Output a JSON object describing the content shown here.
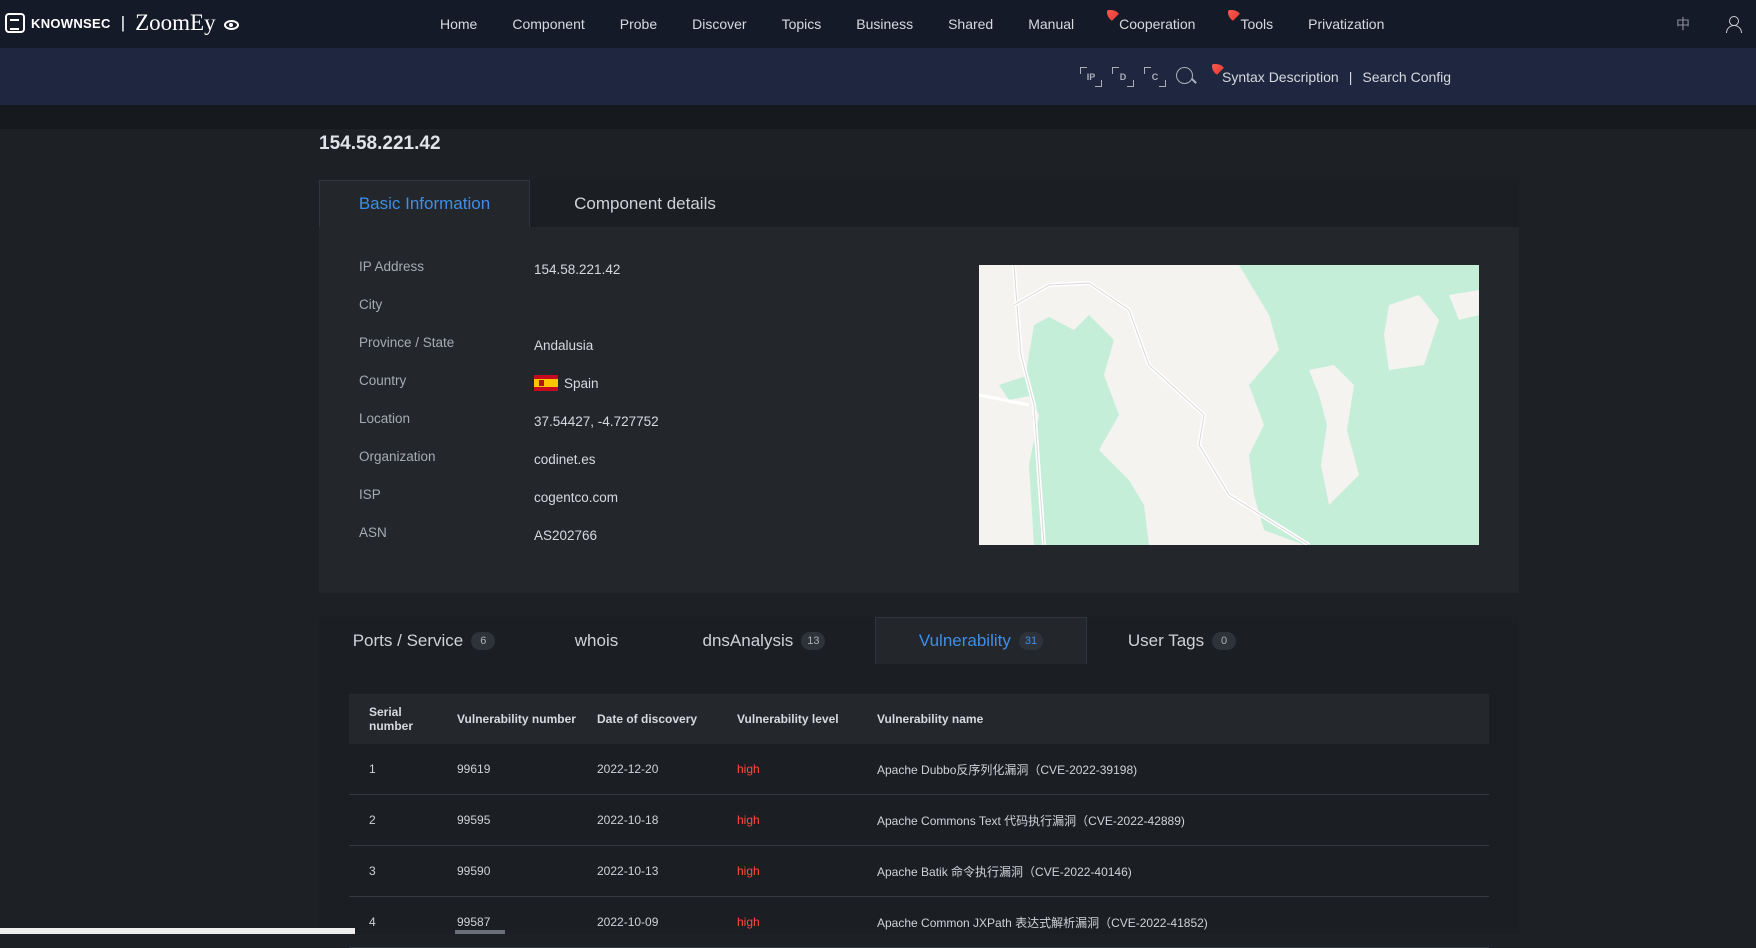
{
  "brand": {
    "company": "KNOWNSEC",
    "separator": "|",
    "product": "ZoomEy"
  },
  "nav": {
    "items": [
      {
        "label": "Home"
      },
      {
        "label": "Component"
      },
      {
        "label": "Probe"
      },
      {
        "label": "Discover"
      },
      {
        "label": "Topics"
      },
      {
        "label": "Business"
      },
      {
        "label": "Shared"
      },
      {
        "label": "Manual"
      },
      {
        "label": "Cooperation",
        "flag": true
      },
      {
        "label": "Tools",
        "flag": true
      },
      {
        "label": "Privatization"
      }
    ],
    "language": "中"
  },
  "search": {
    "tool_icons": [
      "IP",
      "D",
      "C"
    ],
    "syntax_label": "Syntax Description",
    "separator": "|",
    "config_label": "Search Config"
  },
  "host": {
    "ip_title": "154.58.221.42"
  },
  "tabs_top": {
    "basic": "Basic Information",
    "component": "Component details"
  },
  "basic_info": {
    "ip_label": "IP Address",
    "ip_value": "154.58.221.42",
    "city_label": "City",
    "city_value": "",
    "province_label": "Province / State",
    "province_value": "Andalusia",
    "country_label": "Country",
    "country_value": "Spain",
    "location_label": "Location",
    "location_value": "37.54427, -4.727752",
    "org_label": "Organization",
    "org_value": "codinet.es",
    "isp_label": "ISP",
    "isp_value": "cogentco.com",
    "asn_label": "ASN",
    "asn_value": "AS202766"
  },
  "tabs_bottom": {
    "ports": {
      "label": "Ports / Service",
      "count": "6"
    },
    "whois": {
      "label": "whois"
    },
    "dns": {
      "label": "dnsAnalysis",
      "count": "13"
    },
    "vuln": {
      "label": "Vulnerability",
      "count": "31"
    },
    "tags": {
      "label": "User Tags",
      "count": "0"
    }
  },
  "vuln_table": {
    "headers": {
      "serial": "Serial number",
      "number": "Vulnerability number",
      "date": "Date of discovery",
      "level": "Vulnerability level",
      "name": "Vulnerability name"
    },
    "rows": [
      {
        "serial": "1",
        "number": "99619",
        "date": "2022-12-20",
        "level": "high",
        "name": "Apache Dubbo反序列化漏洞（CVE-2022-39198)"
      },
      {
        "serial": "2",
        "number": "99595",
        "date": "2022-10-18",
        "level": "high",
        "name": "Apache Commons Text 代码执行漏洞（CVE-2022-42889)"
      },
      {
        "serial": "3",
        "number": "99590",
        "date": "2022-10-13",
        "level": "high",
        "name": "Apache Batik 命令执行漏洞（CVE-2022-40146)"
      },
      {
        "serial": "4",
        "number": "99587",
        "date": "2022-10-09",
        "level": "high",
        "name": "Apache Common JXPath 表达式解析漏洞（CVE-2022-41852)"
      }
    ]
  },
  "colors": {
    "accent": "#3e8ee8",
    "high_level": "#ff4a3d",
    "nav_bg": "#151a29",
    "search_bg": "#1f2740",
    "map_green": "#c5eed9"
  }
}
